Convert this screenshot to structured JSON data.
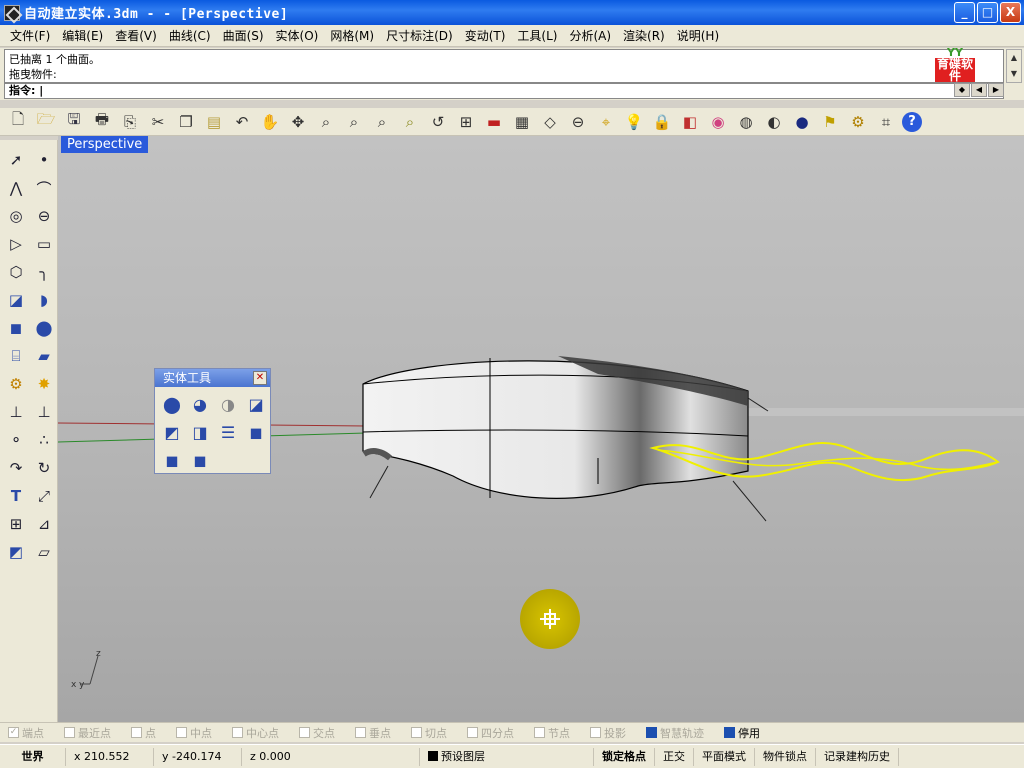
{
  "window": {
    "title": "自动建立实体.3dm -  - [Perspective]",
    "buttons": [
      "_",
      "□",
      "X"
    ]
  },
  "menu": [
    "文件(F)",
    "编辑(E)",
    "查看(V)",
    "曲线(C)",
    "曲面(S)",
    "实体(O)",
    "网格(M)",
    "尺寸标注(D)",
    "变动(T)",
    "工具(L)",
    "分析(A)",
    "渲染(R)",
    "说明(H)"
  ],
  "command": {
    "history": [
      "已抽离 1 个曲面。",
      "拖曳物件:"
    ],
    "prompt": "指令:"
  },
  "logo": {
    "top": "YY",
    "text": "育碟软件"
  },
  "toolbar_icons": [
    "new-file-icon",
    "open-folder-icon",
    "save-icon",
    "print-icon",
    "import-icon",
    "cut-icon",
    "copy-icon",
    "paste-icon",
    "undo-icon",
    "pan-hand-icon",
    "rotate-view-icon",
    "zoom-in-icon",
    "zoom-window-icon",
    "zoom-extents-icon",
    "zoom-selected-icon",
    "undo-view-icon",
    "four-viewports-icon",
    "car-icon",
    "grid-icon",
    "cplane-icon",
    "snap-point-icon",
    "lightbulb-icon",
    "lock-icon",
    "layer-icon",
    "color-wheel-icon",
    "wireframe-sphere-icon",
    "shaded-sphere-icon",
    "render-sphere-icon",
    "lamp-icon",
    "settings-gear-icon",
    "dimension-icon",
    "help-icon"
  ],
  "viewport": {
    "label": "Perspective",
    "axis_labels": {
      "x": "x",
      "y": "y",
      "z": "z"
    }
  },
  "solid_panel": {
    "title": "实体工具",
    "buttons": [
      "boolean-union-icon",
      "boolean-difference-icon",
      "boolean-intersection-icon",
      "boolean-split-icon",
      "cap-holes-icon",
      "extract-surface-icon",
      "offset-solid-icon",
      "fillet-edges-icon",
      "box-solid-icon",
      "shell-solid-icon"
    ]
  },
  "osnaps": [
    {
      "label": "端点",
      "checked": false
    },
    {
      "label": "最近点",
      "checked": false
    },
    {
      "label": "点",
      "checked": false
    },
    {
      "label": "中点",
      "checked": false
    },
    {
      "label": "中心点",
      "checked": false
    },
    {
      "label": "交点",
      "checked": false
    },
    {
      "label": "垂点",
      "checked": false
    },
    {
      "label": "切点",
      "checked": false
    },
    {
      "label": "四分点",
      "checked": false
    },
    {
      "label": "节点",
      "checked": false
    },
    {
      "label": "投影",
      "checked": false
    },
    {
      "label": "智慧轨迹",
      "checked": true
    },
    {
      "label": "停用",
      "checked": true
    }
  ],
  "status": {
    "cplane": "世界",
    "x": "x 210.552",
    "y": "y -240.174",
    "z": "z 0.000",
    "layer": "预设图层",
    "grid_snap": "锁定格点",
    "ortho": "正交",
    "planar": "平面模式",
    "osnap": "物件锁点",
    "history": "记录建构历史"
  },
  "colors": {
    "accent": "#2a5adb",
    "selection": "#f0f000",
    "viewport_bg": "#bcbcbc",
    "gumball": "#c8b400"
  }
}
